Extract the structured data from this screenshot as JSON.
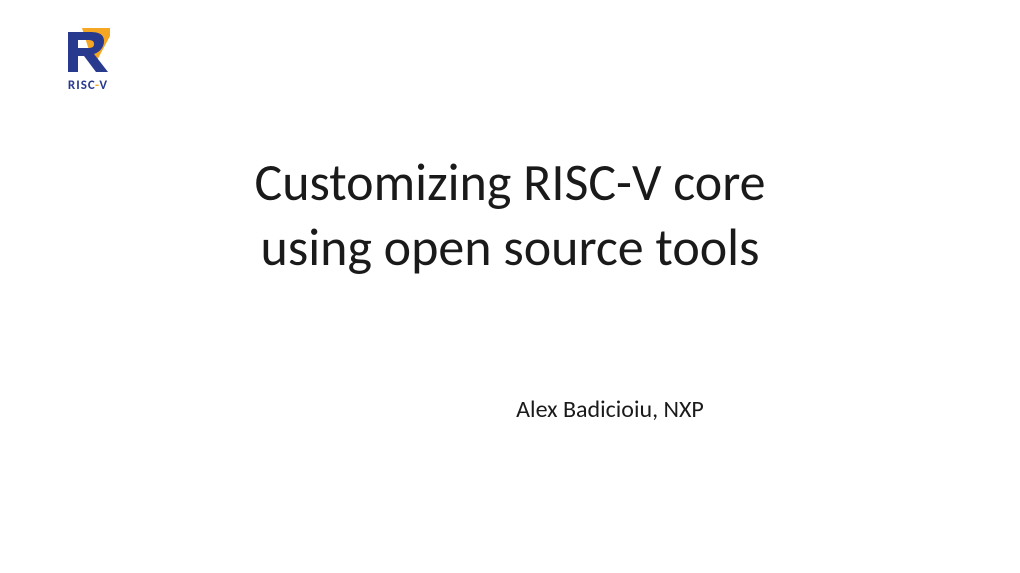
{
  "logo": {
    "name": "RISC-V",
    "text_risc": "RISC",
    "text_dash": "-",
    "text_v": "V",
    "color_blue": "#283a8e",
    "color_yellow": "#f5a623"
  },
  "slide": {
    "title_line1": "Customizing RISC-V core",
    "title_line2": "using open source tools",
    "author": "Alex Badicioiu, NXP"
  }
}
